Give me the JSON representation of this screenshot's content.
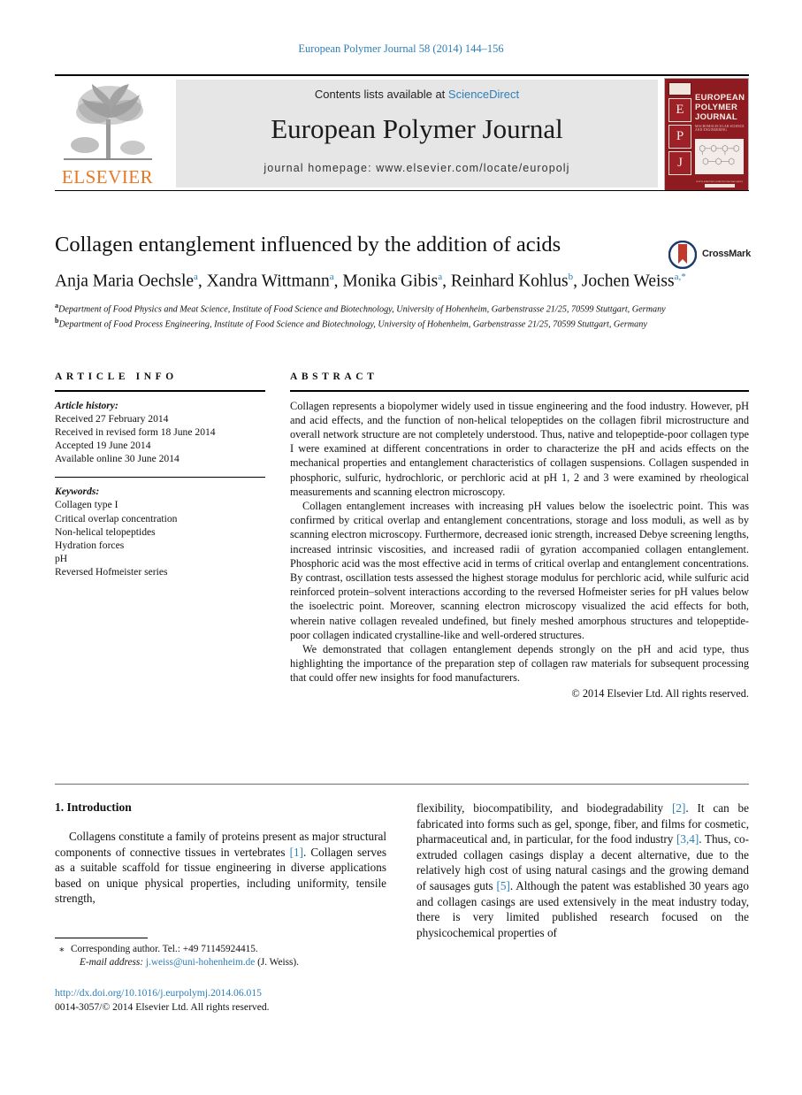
{
  "running_head": "European Polymer Journal 58 (2014) 144–156",
  "masthead": {
    "contents_prefix": "Contents lists available at ",
    "sciencedirect": "ScienceDirect",
    "journal_title": "European Polymer Journal",
    "homepage": "journal homepage: www.elsevier.com/locate/europolj",
    "publisher_wordmark": "ELSEVIER",
    "cover": {
      "letters": [
        "E",
        "P",
        "J"
      ],
      "title_lines": [
        "EUROPEAN",
        "POLYMER",
        "JOURNAL"
      ],
      "subtitle": "MACROMOLECULAR SCIENCE AND ENGINEERING",
      "bottom_text": "www.elsevier.com/locate/europolj",
      "accent_color": "#8d1b20"
    }
  },
  "article": {
    "title": "Collagen entanglement influenced by the addition of acids",
    "crossmark_label": "CrossMark",
    "authors": [
      {
        "name": "Anja Maria Oechsle",
        "sup": "a"
      },
      {
        "name": "Xandra Wittmann",
        "sup": "a"
      },
      {
        "name": "Monika Gibis",
        "sup": "a"
      },
      {
        "name": "Reinhard Kohlus",
        "sup": "b"
      },
      {
        "name": "Jochen Weiss",
        "sup": "a,*"
      }
    ],
    "affiliations": [
      {
        "marker": "a",
        "text": "Department of Food Physics and Meat Science, Institute of Food Science and Biotechnology, University of Hohenheim, Garbenstrasse 21/25, 70599 Stuttgart, Germany"
      },
      {
        "marker": "b",
        "text": "Department of Food Process Engineering, Institute of Food Science and Biotechnology, University of Hohenheim, Garbenstrasse 21/25, 70599 Stuttgart, Germany"
      }
    ]
  },
  "article_info": {
    "heading": "ARTICLE INFO",
    "history_label": "Article history:",
    "history": [
      "Received 27 February 2014",
      "Received in revised form 18 June 2014",
      "Accepted 19 June 2014",
      "Available online 30 June 2014"
    ],
    "keywords_label": "Keywords:",
    "keywords": [
      "Collagen type I",
      "Critical overlap concentration",
      "Non-helical telopeptides",
      "Hydration forces",
      "pH",
      "Reversed Hofmeister series"
    ]
  },
  "abstract": {
    "heading": "ABSTRACT",
    "paragraphs": [
      "Collagen represents a biopolymer widely used in tissue engineering and the food industry. However, pH and acid effects, and the function of non-helical telopeptides on the collagen fibril microstructure and overall network structure are not completely understood. Thus, native and telopeptide-poor collagen type I were examined at different concentrations in order to characterize the pH and acids effects on the mechanical properties and entanglement characteristics of collagen suspensions. Collagen suspended in phosphoric, sulfuric, hydrochloric, or perchloric acid at pH 1, 2 and 3 were examined by rheological measurements and scanning electron microscopy.",
      "Collagen entanglement increases with increasing pH values below the isoelectric point. This was confirmed by critical overlap and entanglement concentrations, storage and loss moduli, as well as by scanning electron microscopy. Furthermore, decreased ionic strength, increased Debye screening lengths, increased intrinsic viscosities, and increased radii of gyration accompanied collagen entanglement. Phosphoric acid was the most effective acid in terms of critical overlap and entanglement concentrations. By contrast, oscillation tests assessed the highest storage modulus for perchloric acid, while sulfuric acid reinforced protein–solvent interactions according to the reversed Hofmeister series for pH values below the isoelectric point. Moreover, scanning electron microscopy visualized the acid effects for both, wherein native collagen revealed undefined, but finely meshed amorphous structures and telopeptide-poor collagen indicated crystalline-like and well-ordered structures.",
      "We demonstrated that collagen entanglement depends strongly on the pH and acid type, thus highlighting the importance of the preparation step of collagen raw materials for subsequent processing that could offer new insights for food manufacturers."
    ],
    "copyright": "© 2014 Elsevier Ltd. All rights reserved."
  },
  "introduction": {
    "heading": "1. Introduction",
    "left_column": "Collagens constitute a family of proteins present as major structural components of connective tissues in vertebrates [1]. Collagen serves as a suitable scaffold for tissue engineering in diverse applications based on unique physical properties, including uniformity, tensile strength,",
    "left_refs": [
      "[1]"
    ],
    "right_column": "flexibility, biocompatibility, and biodegradability [2]. It can be fabricated into forms such as gel, sponge, fiber, and films for cosmetic, pharmaceutical and, in particular, for the food industry [3,4]. Thus, co-extruded collagen casings display a decent alternative, due to the relatively high cost of using natural casings and the growing demand of sausages guts [5]. Although the patent was established 30 years ago and collagen casings are used extensively in the meat industry today, there is very limited published research focused on the physicochemical properties of",
    "right_refs": [
      "[2]",
      "[3,4]",
      "[5]"
    ]
  },
  "footer": {
    "star": "⁎",
    "corresponding": "Corresponding author. Tel.: +49 71145924415.",
    "email_label": "E-mail address:",
    "email": "j.weiss@uni-hohenheim.de",
    "email_owner": "(J. Weiss).",
    "doi": "http://dx.doi.org/10.1016/j.eurpolymj.2014.06.015",
    "issn_line": "0014-3057/© 2014 Elsevier Ltd. All rights reserved."
  },
  "colors": {
    "link": "#2d7fb8",
    "elsevier_orange": "#E87722",
    "cover_red": "#8d1b20"
  }
}
